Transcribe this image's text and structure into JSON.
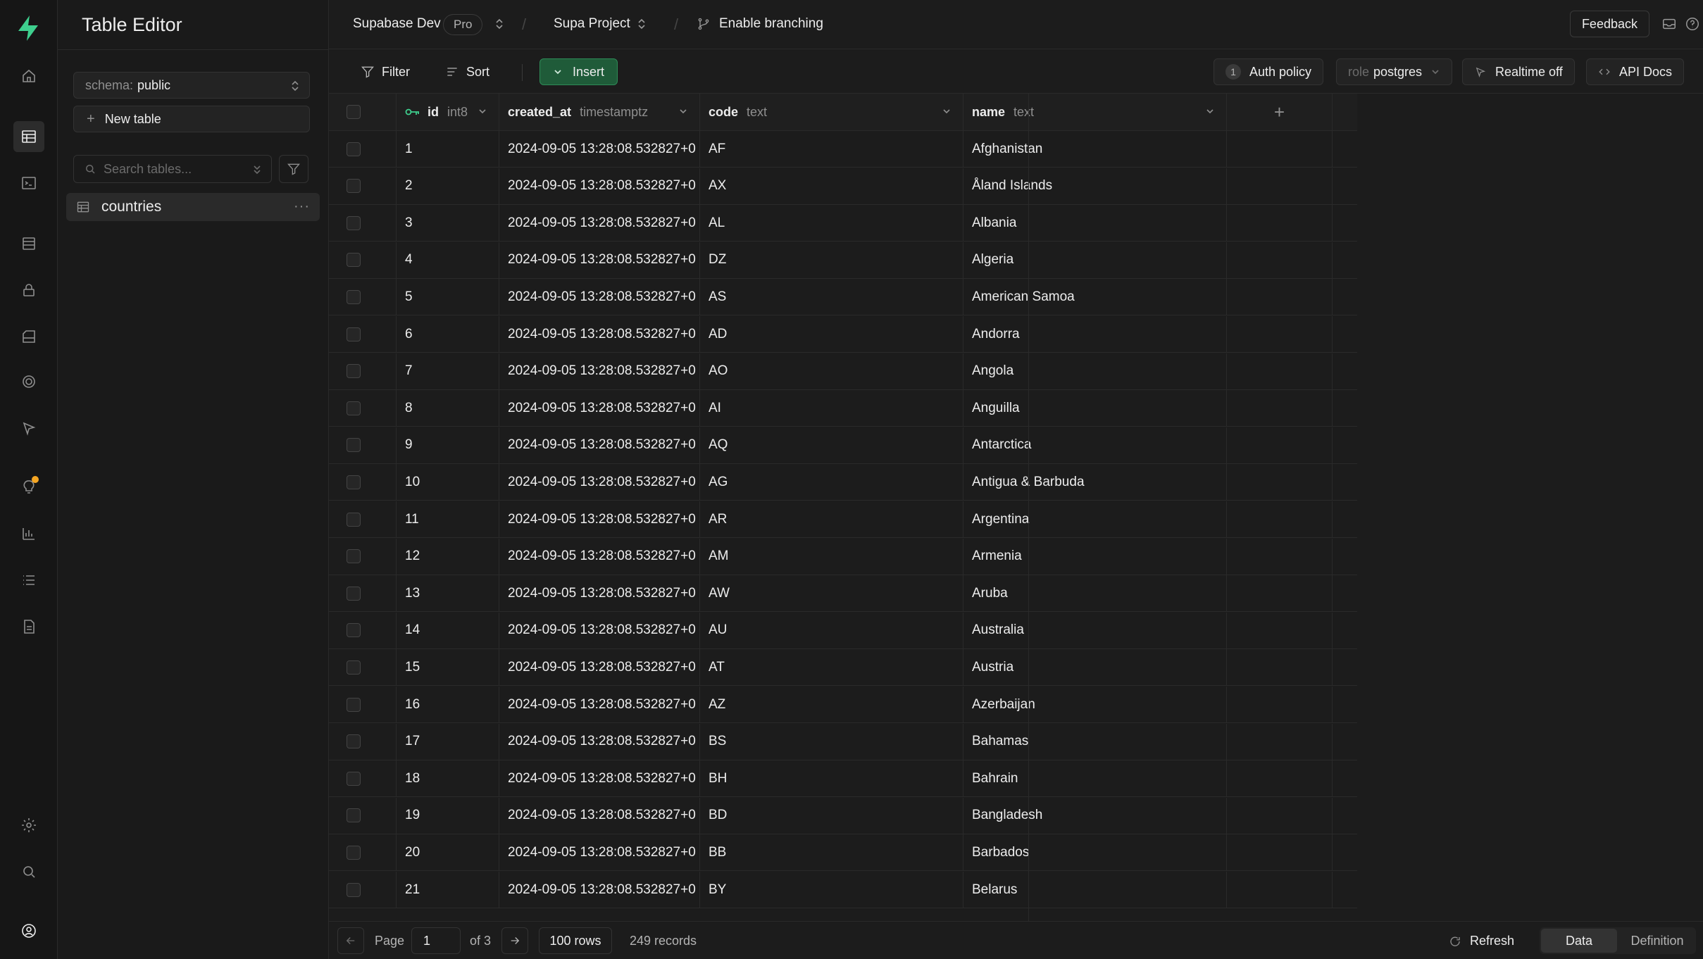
{
  "sidebar": {
    "title": "Table Editor",
    "schema_label": "schema:",
    "schema_value": "public",
    "new_table_label": "New table",
    "search_placeholder": "Search tables...",
    "tables": [
      {
        "name": "countries"
      }
    ]
  },
  "header": {
    "org": "Supabase Dev",
    "plan_badge": "Pro",
    "project": "Supa Project",
    "branching": "Enable branching",
    "feedback": "Feedback"
  },
  "toolbar": {
    "filter": "Filter",
    "sort": "Sort",
    "insert": "Insert",
    "auth_policy_count": "1",
    "auth_policy": "Auth policy",
    "role_label": "role",
    "role_value": "postgres",
    "realtime": "Realtime off",
    "api_docs": "API Docs"
  },
  "grid": {
    "columns": [
      {
        "name": "id",
        "type": "int8",
        "primary_key": true
      },
      {
        "name": "created_at",
        "type": "timestamptz"
      },
      {
        "name": "code",
        "type": "text"
      },
      {
        "name": "name",
        "type": "text"
      }
    ],
    "rows": [
      {
        "id": "1",
        "created_at": "2024-09-05 13:28:08.532827+0",
        "code": "AF",
        "name": "Afghanistan"
      },
      {
        "id": "2",
        "created_at": "2024-09-05 13:28:08.532827+0",
        "code": "AX",
        "name": "Åland Islands"
      },
      {
        "id": "3",
        "created_at": "2024-09-05 13:28:08.532827+0",
        "code": "AL",
        "name": "Albania"
      },
      {
        "id": "4",
        "created_at": "2024-09-05 13:28:08.532827+0",
        "code": "DZ",
        "name": "Algeria"
      },
      {
        "id": "5",
        "created_at": "2024-09-05 13:28:08.532827+0",
        "code": "AS",
        "name": "American Samoa"
      },
      {
        "id": "6",
        "created_at": "2024-09-05 13:28:08.532827+0",
        "code": "AD",
        "name": "Andorra"
      },
      {
        "id": "7",
        "created_at": "2024-09-05 13:28:08.532827+0",
        "code": "AO",
        "name": "Angola"
      },
      {
        "id": "8",
        "created_at": "2024-09-05 13:28:08.532827+0",
        "code": "AI",
        "name": "Anguilla"
      },
      {
        "id": "9",
        "created_at": "2024-09-05 13:28:08.532827+0",
        "code": "AQ",
        "name": "Antarctica"
      },
      {
        "id": "10",
        "created_at": "2024-09-05 13:28:08.532827+0",
        "code": "AG",
        "name": "Antigua & Barbuda"
      },
      {
        "id": "11",
        "created_at": "2024-09-05 13:28:08.532827+0",
        "code": "AR",
        "name": "Argentina"
      },
      {
        "id": "12",
        "created_at": "2024-09-05 13:28:08.532827+0",
        "code": "AM",
        "name": "Armenia"
      },
      {
        "id": "13",
        "created_at": "2024-09-05 13:28:08.532827+0",
        "code": "AW",
        "name": "Aruba"
      },
      {
        "id": "14",
        "created_at": "2024-09-05 13:28:08.532827+0",
        "code": "AU",
        "name": "Australia"
      },
      {
        "id": "15",
        "created_at": "2024-09-05 13:28:08.532827+0",
        "code": "AT",
        "name": "Austria"
      },
      {
        "id": "16",
        "created_at": "2024-09-05 13:28:08.532827+0",
        "code": "AZ",
        "name": "Azerbaijan"
      },
      {
        "id": "17",
        "created_at": "2024-09-05 13:28:08.532827+0",
        "code": "BS",
        "name": "Bahamas"
      },
      {
        "id": "18",
        "created_at": "2024-09-05 13:28:08.532827+0",
        "code": "BH",
        "name": "Bahrain"
      },
      {
        "id": "19",
        "created_at": "2024-09-05 13:28:08.532827+0",
        "code": "BD",
        "name": "Bangladesh"
      },
      {
        "id": "20",
        "created_at": "2024-09-05 13:28:08.532827+0",
        "code": "BB",
        "name": "Barbados"
      },
      {
        "id": "21",
        "created_at": "2024-09-05 13:28:08.532827+0",
        "code": "BY",
        "name": "Belarus"
      }
    ]
  },
  "footer": {
    "page_label": "Page",
    "page_value": "1",
    "of_pages": "of 3",
    "rows_per_page": "100 rows",
    "records": "249 records",
    "refresh": "Refresh",
    "tab_data": "Data",
    "tab_definition": "Definition"
  },
  "colors": {
    "accent": "#3ecf8e",
    "insert_bg": "#1f5b39",
    "background": "#1c1c1c"
  }
}
